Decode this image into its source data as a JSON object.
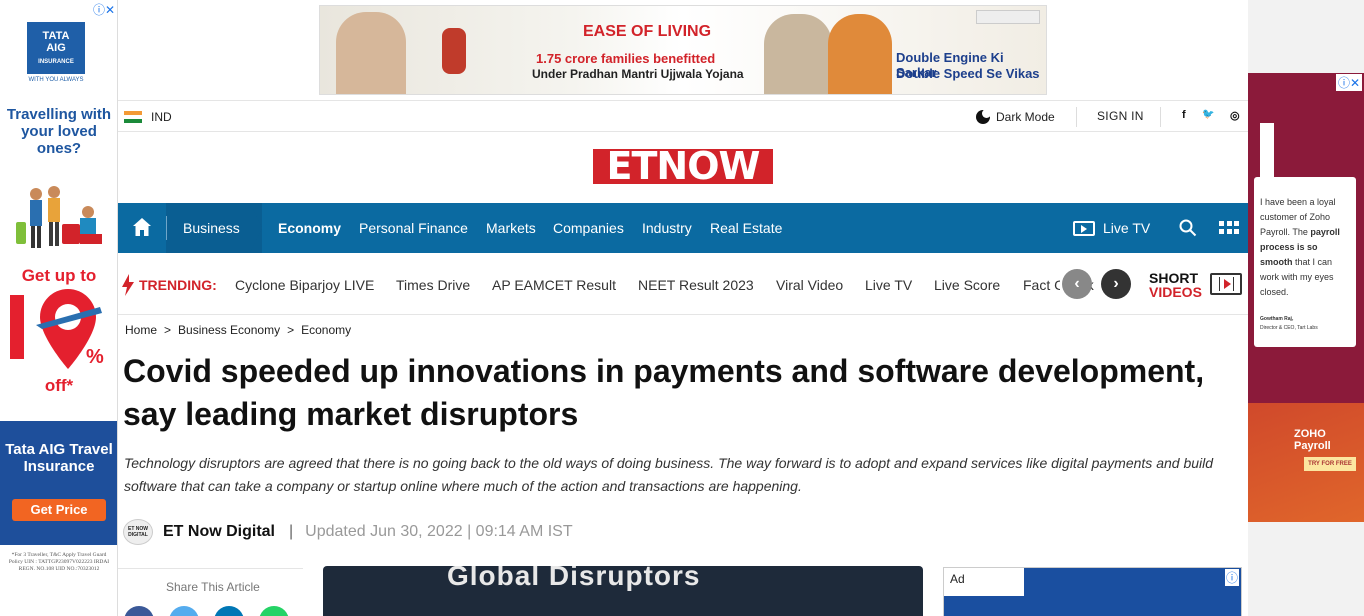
{
  "left_ad": {
    "brand_line1": "TATA",
    "brand_line2": "AIG",
    "brand_line3": "INSURANCE",
    "brand_tag": "WITH YOU ALWAYS",
    "tagline": "Travelling with your loved ones?",
    "offer_top": "Get up to",
    "offer_pct": "10%",
    "offer_bottom": "off*",
    "product": "Tata AIG Travel Insurance",
    "cta": "Get Price",
    "fine_print": "*For 3 Traveller, T&C Apply Travel Guard Policy UIN : TATTGP23097V022223 IRDAI REGN. NO.108 UID NO.:70323012"
  },
  "top_ad": {
    "headline": "EASE OF LIVING",
    "families": "1.75 crore families benefitted",
    "scheme": "Under Pradhan Mantri Ujjwala Yojana",
    "slogan1": "Double Engine Ki Sarkar",
    "slogan2": "Double Speed Se Vikas"
  },
  "util": {
    "country": "IND",
    "dark_mode": "Dark Mode",
    "sign_in": "SIGN IN",
    "social": [
      "f",
      "🐦",
      "◎"
    ]
  },
  "brand": {
    "logo_text": "ETNOW"
  },
  "nav": {
    "section": "Business",
    "items": [
      "Economy",
      "Personal Finance",
      "Markets",
      "Companies",
      "Industry",
      "Real Estate"
    ],
    "live_tv": "Live TV"
  },
  "trending": {
    "label": "TRENDING:",
    "items": [
      "Cyclone Biparjoy LIVE",
      "Times Drive",
      "AP EAMCET Result",
      "NEET Result 2023",
      "Viral Video",
      "Live TV",
      "Live Score",
      "Fact Check"
    ],
    "shorts_line1": "SHORT",
    "shorts_line2": "VIDEOS"
  },
  "breadcrumb": [
    "Home",
    ">",
    "Business Economy",
    ">",
    "Economy"
  ],
  "article": {
    "headline": "Covid speeded up innovations in payments and software development, say leading market disruptors",
    "summary": "Technology disruptors are agreed that there is no going back to the old ways of doing business. The way forward is to adopt and expand services like digital payments and build software that can take a company or startup online where much of the action and transactions are happening.",
    "author_badge": "ET NOW DIGITAL",
    "author": "ET Now Digital",
    "separator": "|",
    "updated": "Updated Jun 30, 2022 | 09:14 AM IST",
    "share_label": "Share This Article",
    "hero_text": "Global Disruptors"
  },
  "right_ad": {
    "testimonial_pre": "I have been a loyal customer of Zoho Payroll. The",
    "testimonial_bold": "payroll process is so smooth",
    "testimonial_post": "that I can work with my eyes closed.",
    "author_name": "Gowtham Raj,",
    "author_title": "Director & CEO, Tart Labs",
    "brand": "ZOHO Payroll",
    "cta": "TRY FOR FREE"
  },
  "side_ad": {
    "tag": "Ad"
  },
  "colors": {
    "brand_red": "#d2232a",
    "nav_blue": "#0b6aa1"
  }
}
